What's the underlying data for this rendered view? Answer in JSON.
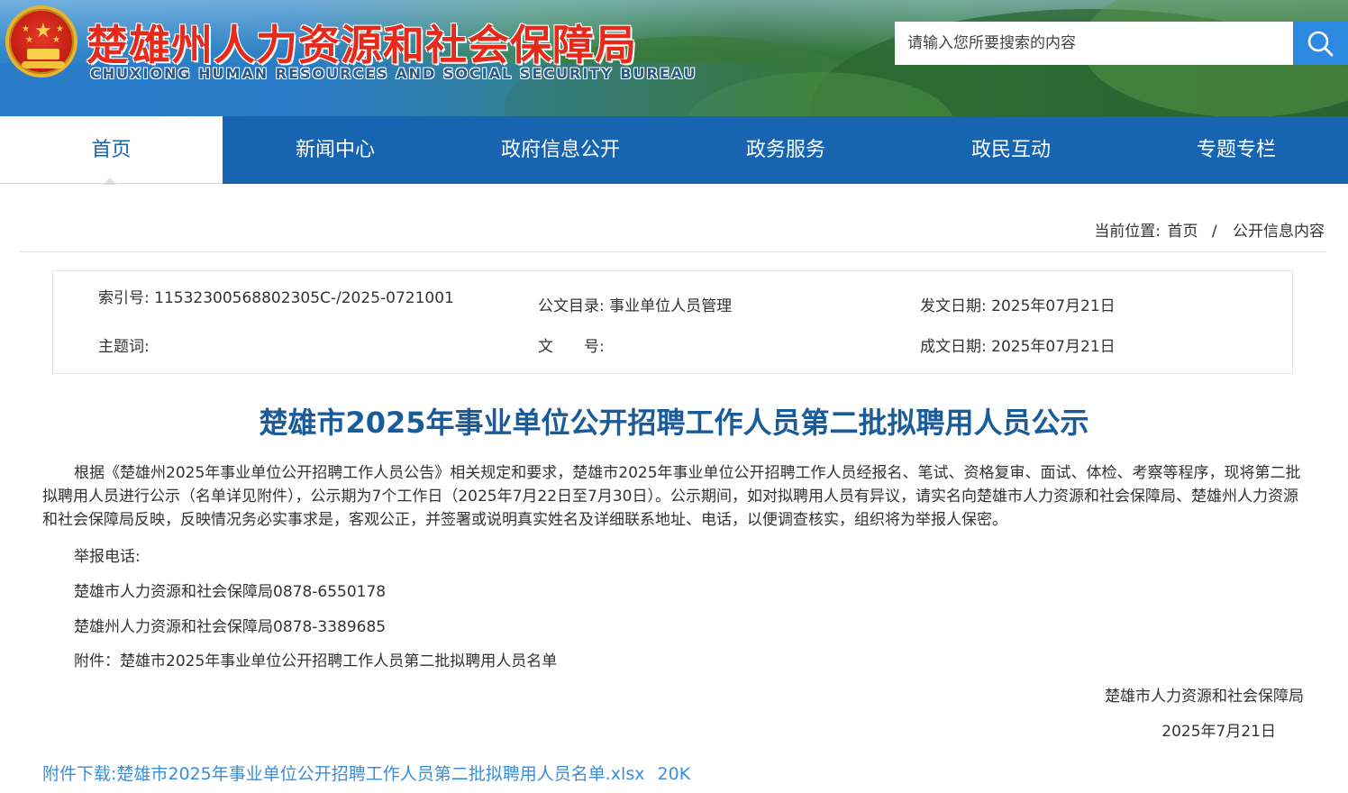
{
  "header": {
    "title": "楚雄州人力资源和社会保障局",
    "subtitle": "CHUXIONG HUMAN RESOURCES AND SOCIAL SECURITY BUREAU",
    "search_placeholder": "请输入您所要搜索的内容"
  },
  "nav": {
    "items": [
      {
        "label": "首页",
        "active": true
      },
      {
        "label": "新闻中心"
      },
      {
        "label": "政府信息公开"
      },
      {
        "label": "政务服务"
      },
      {
        "label": "政民互动"
      },
      {
        "label": "专题专栏"
      }
    ]
  },
  "breadcrumb": {
    "prefix": "当前位置:",
    "items": [
      "首页",
      "公开信息内容"
    ],
    "separator": "/"
  },
  "meta": {
    "index_label": "索引号:",
    "index_value": "11532300568802305C-/2025-0721001",
    "catalog_label": "公文目录:",
    "catalog_value": "事业单位人员管理",
    "issue_date_label": "发文日期:",
    "issue_date_value": "2025年07月21日",
    "subject_label": "主题词:",
    "subject_value": "",
    "doc_no_label": "文　　号:",
    "doc_no_value": "",
    "made_date_label": "成文日期:",
    "made_date_value": "2025年07月21日"
  },
  "article": {
    "title": "楚雄市2025年事业单位公开招聘工作人员第二批拟聘用人员公示",
    "body": "根据《楚雄州2025年事业单位公开招聘工作人员公告》相关规定和要求，楚雄市2025年事业单位公开招聘工作人员经报名、笔试、资格复审、面试、体检、考察等程序，现将第二批拟聘用人员进行公示（名单详见附件），公示期为7个工作日（2025年7月22日至7月30日）。公示期间，如对拟聘用人员有异议，请实名向楚雄市人力资源和社会保障局、楚雄州人力资源和社会保障局反映，反映情况务必实事求是，客观公正，并签署或说明真实姓名及详细联系地址、电话，以便调查核实，组织将为举报人保密。",
    "report_label": "举报电话:",
    "phone_city": "楚雄市人力资源和社会保障局0878-6550178",
    "phone_prefecture": "楚雄州人力资源和社会保障局0878-3389685",
    "attachment_line": "附件：楚雄市2025年事业单位公开招聘工作人员第二批拟聘用人员名单",
    "signature_org": "楚雄市人力资源和社会保障局",
    "signature_date": "2025年7月21日"
  },
  "download": {
    "label": "附件下载:楚雄市2025年事业单位公开招聘工作人员第二批拟聘用人员名单.xlsx",
    "size": "20K"
  },
  "colors": {
    "nav_bg": "#1764b1",
    "title_blue": "#1a5b9a",
    "link_blue": "#3a8ed6",
    "header_red": "#e52a1c",
    "search_btn": "#2d8ae0"
  },
  "icons": {
    "emblem": "national-emblem-icon",
    "search": "search-icon"
  }
}
